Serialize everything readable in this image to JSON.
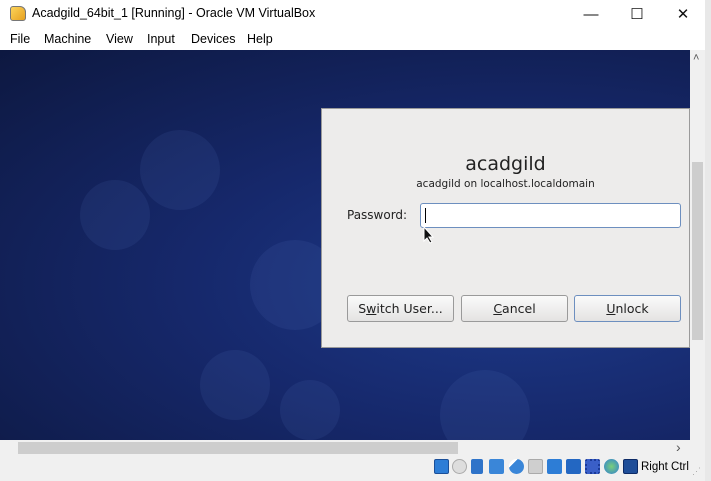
{
  "window": {
    "title": "Acadgild_64bit_1 [Running] - Oracle VM VirtualBox",
    "minimize": "—",
    "maximize": "☐",
    "close": "✕"
  },
  "menu": [
    "File",
    "Machine",
    "View",
    "Input",
    "Devices",
    "Help"
  ],
  "lock_dialog": {
    "username": "acadgild",
    "host": "acadgild on localhost.localdomain",
    "password_label": "Password:",
    "password_value": "",
    "buttons": {
      "switch_user": {
        "pre": "S",
        "mn": "w",
        "post": "itch User..."
      },
      "cancel": {
        "pre": "",
        "mn": "C",
        "post": "ancel"
      },
      "unlock": {
        "pre": "",
        "mn": "U",
        "post": "nlock"
      }
    }
  },
  "scroll": {
    "up": "˄",
    "right": "›"
  },
  "statusbar": {
    "icons": [
      "hard-disk-icon",
      "optical-drive-icon",
      "audio-icon",
      "network-icon",
      "usb-icon",
      "shared-folders-icon",
      "display-icon",
      "video-capture-icon",
      "cpu-icon",
      "guest-additions-icon",
      "mouse-integration-icon"
    ],
    "host_key": "Right Ctrl"
  }
}
